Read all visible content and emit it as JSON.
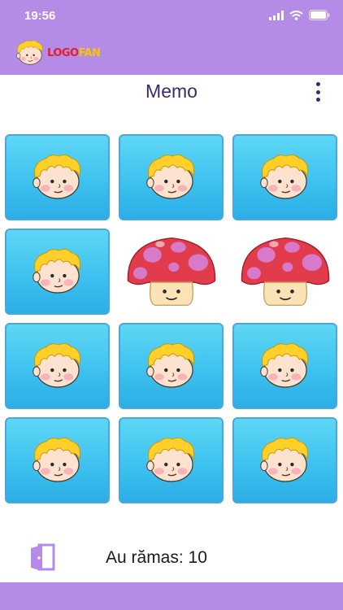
{
  "status": {
    "time": "19:56"
  },
  "logo": {
    "text_part1": "LOGO",
    "text_part2": "FAN"
  },
  "header": {
    "title": "Memo"
  },
  "cards": [
    {
      "state": "hidden",
      "icon": "boy-face-icon"
    },
    {
      "state": "hidden",
      "icon": "boy-face-icon"
    },
    {
      "state": "hidden",
      "icon": "boy-face-icon"
    },
    {
      "state": "hidden",
      "icon": "boy-face-icon"
    },
    {
      "state": "revealed",
      "icon": "mushroom-icon"
    },
    {
      "state": "revealed",
      "icon": "mushroom-icon"
    },
    {
      "state": "hidden",
      "icon": "boy-face-icon"
    },
    {
      "state": "hidden",
      "icon": "boy-face-icon"
    },
    {
      "state": "hidden",
      "icon": "boy-face-icon"
    },
    {
      "state": "hidden",
      "icon": "boy-face-icon"
    },
    {
      "state": "hidden",
      "icon": "boy-face-icon"
    },
    {
      "state": "hidden",
      "icon": "boy-face-icon"
    }
  ],
  "footer": {
    "remaining_label": "Au rămas: 10"
  },
  "colors": {
    "accent": "#b48ce8",
    "card": "#3ec2ef",
    "title": "#3a2a6e"
  }
}
